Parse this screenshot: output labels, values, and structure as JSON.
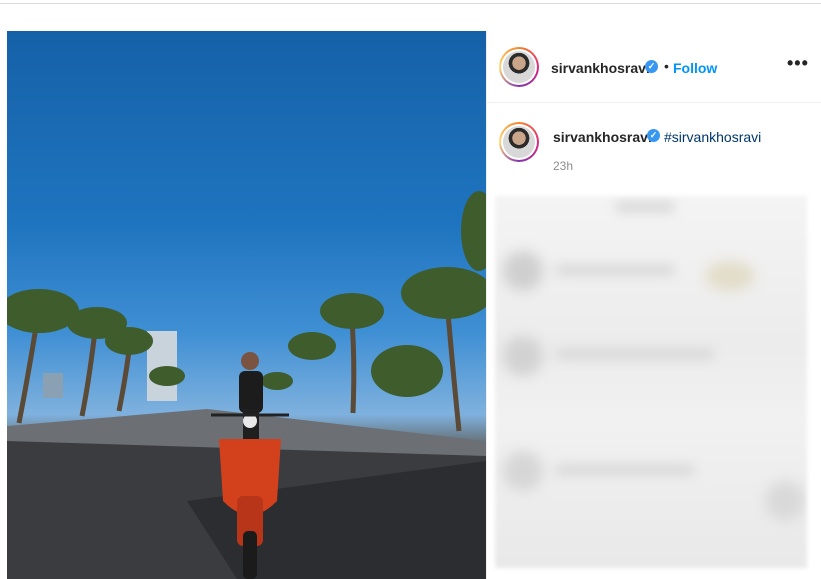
{
  "post": {
    "username": "sirvankhosravi",
    "follow_label": "Follow",
    "separator": "•",
    "more_label": "•••",
    "verified_mark": "✓",
    "caption_hashtag": "#sirvankhosravi",
    "time_ago": "23h"
  },
  "icons": [
    "verified-badge-icon",
    "more-options-icon"
  ],
  "colors": {
    "follow": "#0095f6",
    "verified": "#3897f0",
    "hashtag": "#00376b"
  }
}
